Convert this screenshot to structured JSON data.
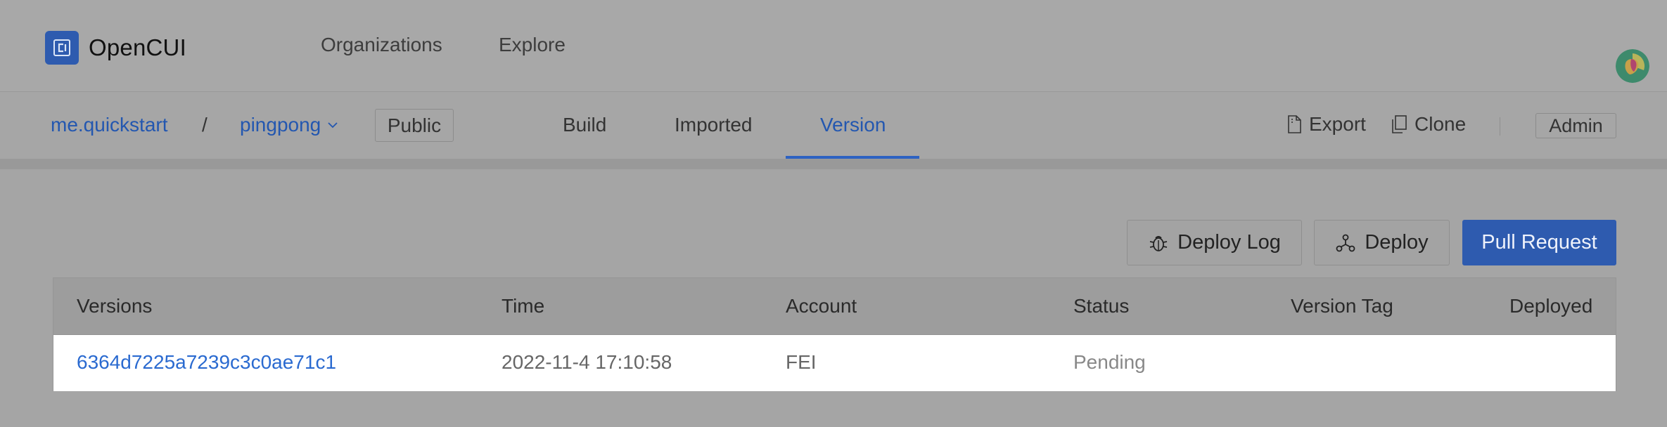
{
  "header": {
    "brand": "OpenCUI",
    "nav": [
      "Organizations",
      "Explore"
    ]
  },
  "subnav": {
    "breadcrumb": {
      "org": "me.quickstart",
      "separator": "/",
      "project": "pingpong"
    },
    "visibility": "Public",
    "tabs": [
      {
        "label": "Build",
        "active": false
      },
      {
        "label": "Imported",
        "active": false
      },
      {
        "label": "Version",
        "active": true
      }
    ],
    "actions": {
      "export": "Export",
      "clone": "Clone",
      "admin": "Admin"
    }
  },
  "toolbar": {
    "deploy_log": "Deploy Log",
    "deploy": "Deploy",
    "pull_request": "Pull Request"
  },
  "table": {
    "columns": [
      "Versions",
      "Time",
      "Account",
      "Status",
      "Version Tag",
      "Deployed"
    ],
    "rows": [
      {
        "version": "6364d7225a7239c3c0ae71c1",
        "time": "2022-11-4 17:10:58",
        "account": "FEI",
        "status": "Pending",
        "version_tag": "",
        "deployed": ""
      }
    ]
  },
  "colors": {
    "brand": "#2e5baf",
    "link": "#2357b0",
    "active_tab_underline": "#2d62c2"
  },
  "icons": [
    "opencui-logo-icon",
    "chevron-down-icon",
    "file-icon",
    "copy-icon",
    "bug-icon",
    "network-icon",
    "user-avatar"
  ]
}
